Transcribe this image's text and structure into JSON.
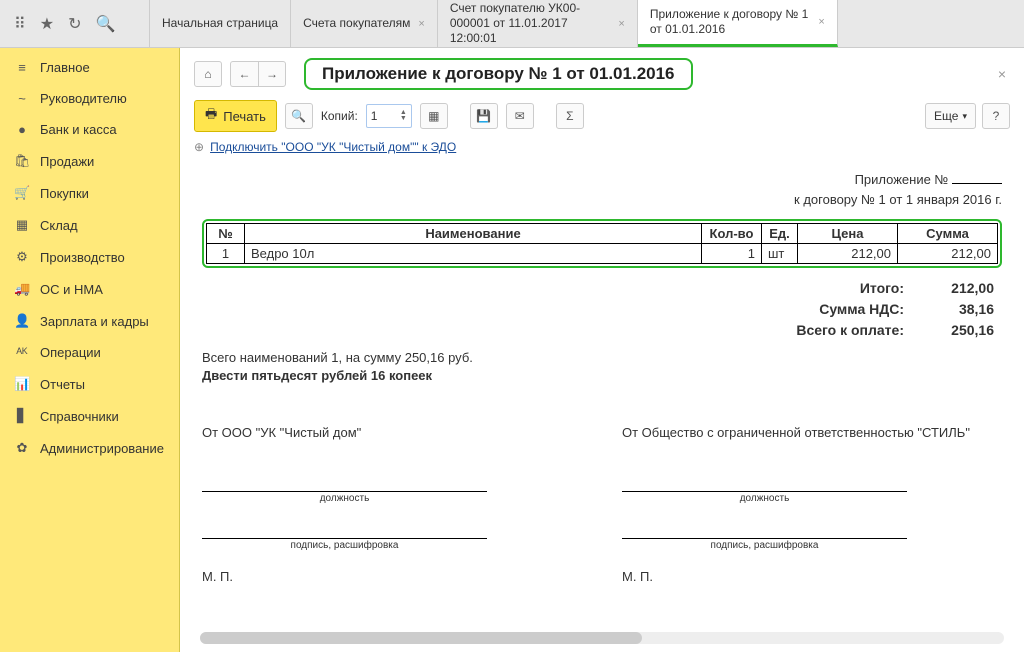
{
  "tabs": [
    {
      "label": "Начальная страница"
    },
    {
      "label": "Счета покупателям"
    },
    {
      "label": "Счет покупателю УК00-000001 от 11.01.2017 12:00:01"
    },
    {
      "label": "Приложение к договору № 1 от 01.01.2016"
    }
  ],
  "sidebar": {
    "items": [
      {
        "icon": "≡",
        "label": "Главное"
      },
      {
        "icon": "~",
        "label": "Руководителю"
      },
      {
        "icon": "●",
        "label": "Банк и касса"
      },
      {
        "icon": "🛍",
        "label": "Продажи"
      },
      {
        "icon": "🛒",
        "label": "Покупки"
      },
      {
        "icon": "▦",
        "label": "Склад"
      },
      {
        "icon": "⚙",
        "label": "Производство"
      },
      {
        "icon": "🚚",
        "label": "ОС и НМА"
      },
      {
        "icon": "👤",
        "label": "Зарплата и кадры"
      },
      {
        "icon": "ᴬᴷ",
        "label": "Операции"
      },
      {
        "icon": "📊",
        "label": "Отчеты"
      },
      {
        "icon": "▋",
        "label": "Справочники"
      },
      {
        "icon": "✿",
        "label": "Администрирование"
      }
    ]
  },
  "header": {
    "title": "Приложение к договору № 1 от 01.01.2016"
  },
  "toolbar": {
    "print_label": "Печать",
    "copies_label": "Копий:",
    "copies_value": "1",
    "more_label": "Еще"
  },
  "edo": {
    "link": "Подключить \"ООО \"УК \"Чистый дом\"\" к ЭДО"
  },
  "doc": {
    "head_line1": "Приложение №",
    "head_line2": "к договору № 1 от 1 января 2016 г.",
    "columns": {
      "num": "№",
      "name": "Наименование",
      "qty": "Кол-во",
      "unit": "Ед.",
      "price": "Цена",
      "sum": "Сумма"
    },
    "rows": [
      {
        "num": "1",
        "name": "Ведро 10л",
        "qty": "1",
        "unit": "шт",
        "price": "212,00",
        "sum": "212,00"
      }
    ],
    "totals": {
      "itogo_label": "Итого:",
      "itogo_val": "212,00",
      "nds_label": "Сумма НДС:",
      "nds_val": "38,16",
      "total_label": "Всего к оплате:",
      "total_val": "250,16"
    },
    "summary1": "Всего наименований 1, на сумму 250,16 руб.",
    "summary2": "Двести пятьдесят рублей 16 копеек",
    "sign": {
      "from1": "От ООО \"УК \"Чистый дом\"",
      "from2": "От Общество с ограниченной ответственностью \"СТИЛЬ\"",
      "position": "должность",
      "decipher": "подпись, расшифровка",
      "mp": "М. П."
    }
  }
}
